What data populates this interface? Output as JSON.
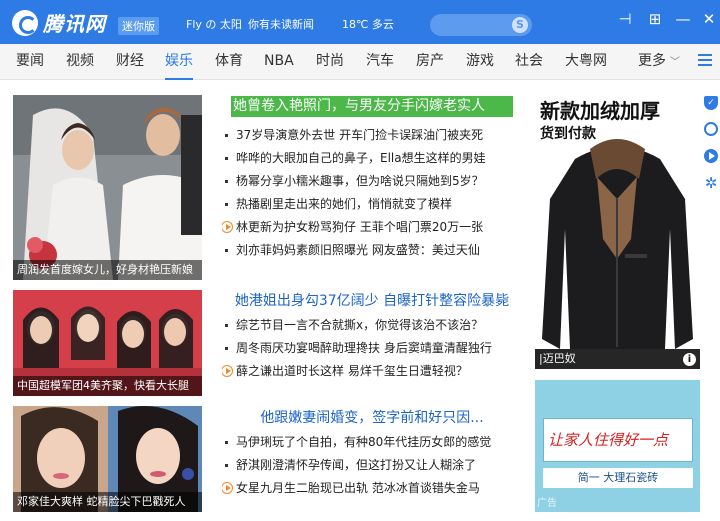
{
  "app": {
    "logo_text": "腾讯网",
    "badge": "迷你版",
    "user": "Fly の 太阳",
    "unread": "你有未读新闻",
    "weather": "18℃ 多云",
    "search_icon_label": "S"
  },
  "colors": {
    "titlebar": "#2e7be5",
    "link_blue": "#1c64c7",
    "highlight_green": "#4bb849",
    "video_orange": "#f08a24"
  },
  "nav": {
    "items": [
      "要闻",
      "视频",
      "财经",
      "娱乐",
      "体育",
      "NBA",
      "时尚",
      "汽车",
      "房产",
      "游戏",
      "社会",
      "大粤网"
    ],
    "active": "娱乐",
    "more": "更多"
  },
  "photos": [
    {
      "caption": "周润发首度嫁女儿，好身材艳压新娘"
    },
    {
      "caption": "中国超模军团4美齐聚，快看大长腿"
    },
    {
      "caption": "邓家佳大爽样  蛇精脸尖下巴戳死人"
    }
  ],
  "sections": [
    {
      "headline": "她曾卷入艳照门，与男友分手闪嫁老实人",
      "items": [
        {
          "text": "37岁导演意外去世  开车门捡卡误踩油门被夹死",
          "video": false
        },
        {
          "text": "哗哗的大眼加自己的鼻子，Ella想生这样的男娃",
          "video": false
        },
        {
          "text": "杨幂分享小糯米趣事，但为啥说只隔她到5岁？",
          "video": false
        },
        {
          "text": "热播剧里走出来的她们，悄悄就变了模样",
          "video": false
        },
        {
          "text": "林更新为护女粉骂狗仔  王菲个唱门票20万一张",
          "video": true
        },
        {
          "text": "刘亦菲妈妈素颜旧照曝光  网友盛赞：美过天仙",
          "video": false
        }
      ]
    },
    {
      "headline": "她港姐出身勾37亿阔少 自曝打针整容险暴毙",
      "items": [
        {
          "text": "综艺节目一言不合就撕x，你觉得该治不该治？",
          "video": false
        },
        {
          "text": "周冬雨厌功宴喝醉助理搀扶  身后窦靖童清醒独行",
          "video": false
        },
        {
          "text": "薛之谦出道时长这样  易烊千玺生日遭轻视？",
          "video": true
        }
      ]
    },
    {
      "headline": "他跟嫩妻闹婚变，签字前和好只因...",
      "items": [
        {
          "text": "马伊琍玩了个自拍，有种80年代挂历女郎的感觉",
          "video": false
        },
        {
          "text": "舒淇刚澄清怀孕传闻，但这打扮又让人糊涂了",
          "video": false
        },
        {
          "text": "女星九月生二胎现已出轨  范冰冰首谈错失金马",
          "video": true
        }
      ]
    }
  ],
  "ads": {
    "jacket": {
      "title": "新款加绒加厚",
      "subtitle": "货到付款",
      "source": "|迈巴奴",
      "info": "i"
    },
    "stone": {
      "slogan": "让家人住得好一点",
      "brand": "简一 大理石瓷砖",
      "tag": "广告"
    }
  },
  "rail_icons": [
    "shield-icon",
    "refresh-icon",
    "play-icon",
    "settings-icon"
  ]
}
